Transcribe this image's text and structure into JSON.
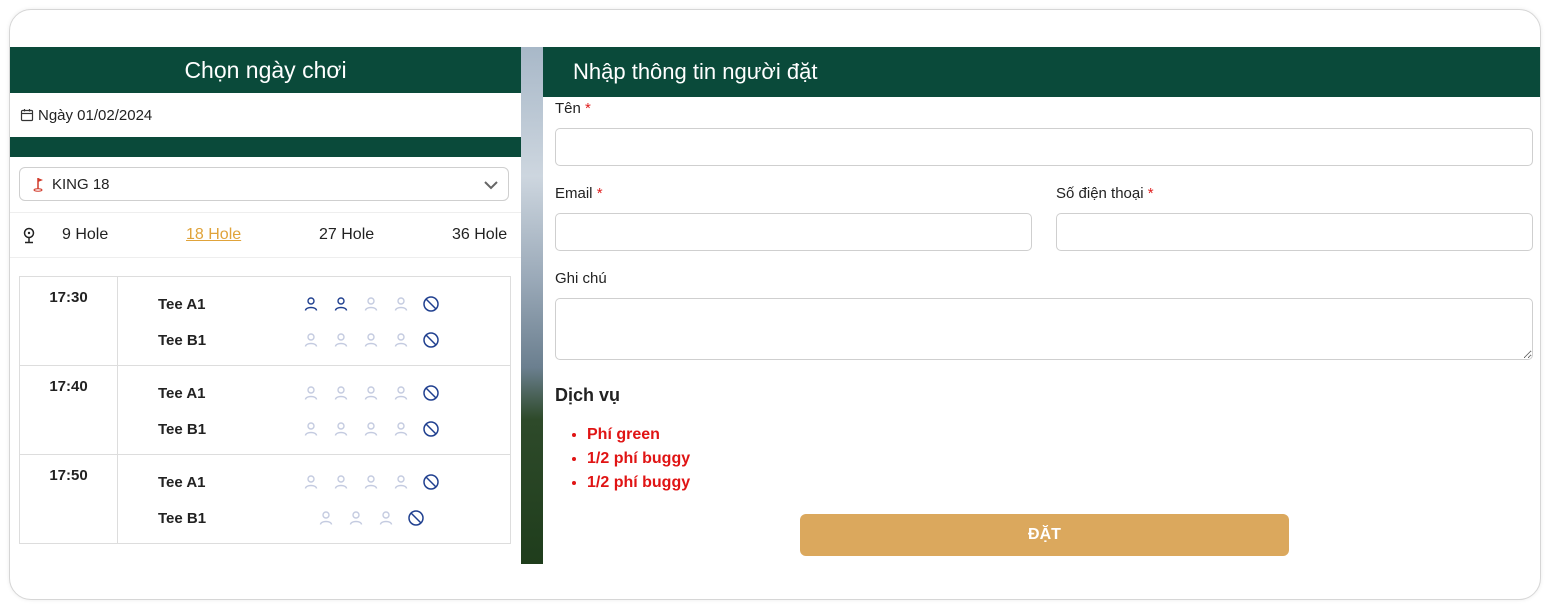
{
  "left": {
    "title": "Chọn ngày chơi",
    "date_label": "Ngày 01/02/2024",
    "course": "KING 18",
    "holes": [
      {
        "label": "9 Hole",
        "active": false
      },
      {
        "label": "18 Hole",
        "active": true
      },
      {
        "label": "27 Hole",
        "active": false
      },
      {
        "label": "36 Hole",
        "active": false
      }
    ],
    "slots": [
      {
        "time": "17:30",
        "tees": [
          {
            "name": "Tee A1",
            "booked": 2,
            "seats": 4
          },
          {
            "name": "Tee B1",
            "booked": 0,
            "seats": 4
          }
        ]
      },
      {
        "time": "17:40",
        "tees": [
          {
            "name": "Tee A1",
            "booked": 0,
            "seats": 4
          },
          {
            "name": "Tee B1",
            "booked": 0,
            "seats": 4
          }
        ]
      },
      {
        "time": "17:50",
        "tees": [
          {
            "name": "Tee A1",
            "booked": 0,
            "seats": 4
          },
          {
            "name": "Tee B1",
            "booked": 0,
            "seats": 3
          }
        ]
      }
    ]
  },
  "right": {
    "title": "Nhập thông tin người đặt",
    "name_label": "Tên",
    "email_label": "Email",
    "phone_label": "Số điện thoại",
    "required_mark": "*",
    "note_label": "Ghi chú",
    "name_value": "",
    "email_value": "",
    "phone_value": "",
    "note_value": "",
    "services_title": "Dịch vụ",
    "services": [
      "Phí green",
      "1/2 phí buggy",
      "1/2 phí buggy"
    ],
    "submit_label": "ĐẶT"
  },
  "colors": {
    "header_green": "#0a4a3a",
    "accent_orange": "#e0a33a",
    "button_gold": "#dba85d",
    "required_red": "#e01e1e",
    "seat_booked": "#1f3f8f",
    "seat_free": "#c4cbe0"
  },
  "icons": {
    "date": "calendar-icon",
    "course": "golf-flag-icon",
    "holes": "golf-pin-icon",
    "dropdown": "chevron-down-icon",
    "seat": "person-icon",
    "blocked": "block-icon"
  }
}
